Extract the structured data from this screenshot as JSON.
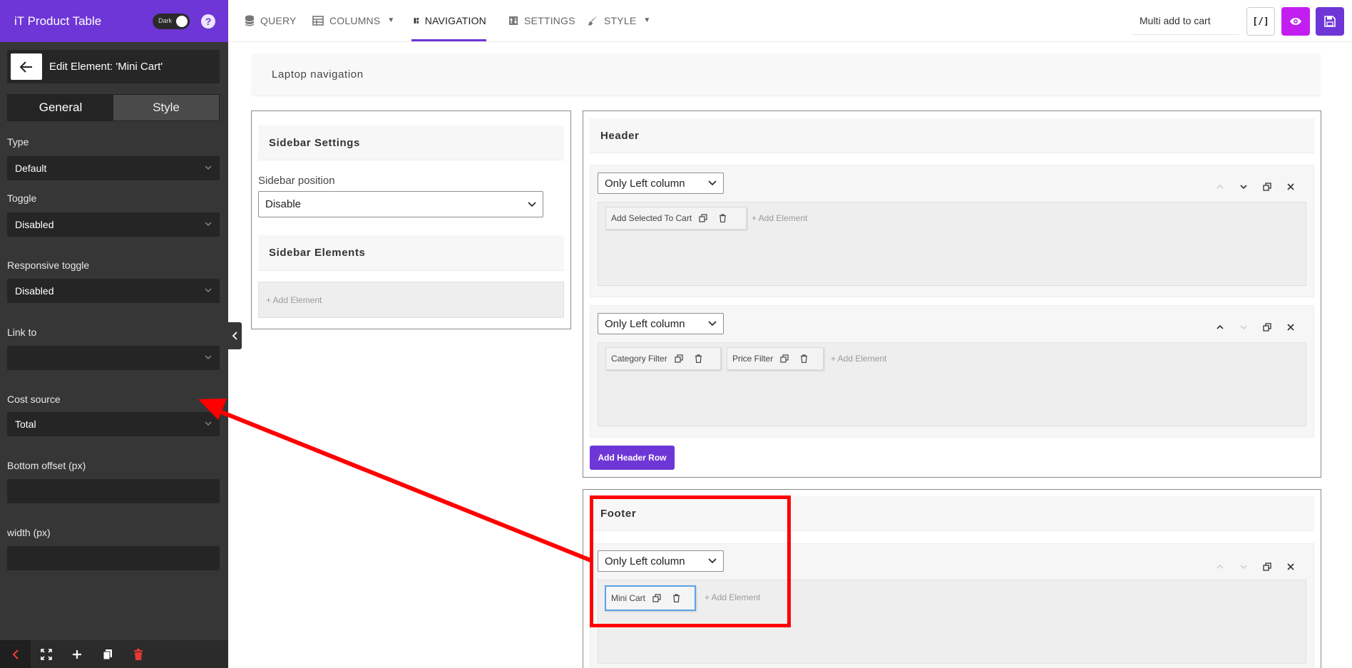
{
  "sidebar": {
    "brand": "iT Product Table",
    "dark_label": "Dark",
    "help_label": "?",
    "edit_title": "Edit Element: 'Mini Cart'",
    "tabs": [
      "General",
      "Style"
    ],
    "fields": {
      "type": {
        "label": "Type",
        "value": "Default"
      },
      "toggle": {
        "label": "Toggle",
        "value": "Disabled"
      },
      "responsive_toggle": {
        "label": "Responsive toggle",
        "value": "Disabled"
      },
      "link_to": {
        "label": "Link to",
        "value": ""
      },
      "cost_source": {
        "label": "Cost source",
        "value": "Total"
      },
      "bottom_offset": {
        "label": "Bottom offset (px)",
        "value": ""
      },
      "width": {
        "label": "width (px)",
        "value": ""
      }
    },
    "footer_icons": [
      "chevron-left-icon",
      "fullscreen-icon",
      "plus-icon",
      "copy-icon",
      "trash-icon"
    ]
  },
  "topbar": {
    "nav": [
      {
        "label": "QUERY",
        "icon": "database-icon"
      },
      {
        "label": "COLUMNS",
        "icon": "table-icon",
        "dropdown": true
      },
      {
        "label": "NAVIGATION",
        "icon": "navigation-icon",
        "active": true
      },
      {
        "label": "SETTINGS",
        "icon": "settings-icon"
      },
      {
        "label": "STYLE",
        "icon": "brush-icon",
        "dropdown": true
      }
    ],
    "preset_value": "Multi add to cart",
    "code_label": "[/]"
  },
  "content": {
    "laptop_title": "Laptop navigation",
    "sidebar_settings": {
      "title": "Sidebar Settings",
      "position_label": "Sidebar position",
      "position_value": "Disable",
      "elements_title": "Sidebar Elements",
      "add_element": "+ Add Element"
    },
    "header": {
      "title": "Header",
      "rows": [
        {
          "layout": "Only Left column",
          "elements": [
            "Add Selected To Cart"
          ],
          "add_element": "+ Add Element"
        },
        {
          "layout": "Only Left column",
          "elements": [
            "Category Filter",
            "Price Filter"
          ],
          "add_element": "+ Add Element"
        }
      ],
      "add_row": "Add Header Row"
    },
    "footer": {
      "title": "Footer",
      "rows": [
        {
          "layout": "Only Left column",
          "elements": [
            "Mini Cart"
          ],
          "add_element": "+ Add Element"
        }
      ]
    }
  },
  "colors": {
    "brand": "#6e36d6",
    "preview": "#c21ef0",
    "sidebar_bg": "#363636",
    "annotation": "#ff0000",
    "selected_border": "#5aa2e6"
  }
}
